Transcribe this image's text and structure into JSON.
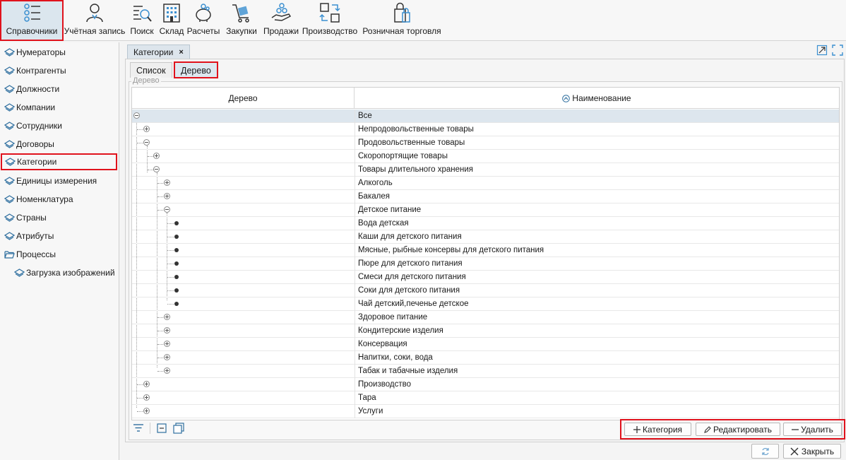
{
  "toolbar": {
    "items": [
      {
        "label": "Справочники",
        "icon": "list-settings-icon"
      },
      {
        "label": "Учётная запись",
        "icon": "user-icon"
      },
      {
        "label": "Поиск",
        "icon": "search-document-icon"
      },
      {
        "label": "Склад",
        "icon": "building-icon"
      },
      {
        "label": "Расчеты",
        "icon": "piggy-bank-icon"
      },
      {
        "label": "Закупки",
        "icon": "cart-icon"
      },
      {
        "label": "Продажи",
        "icon": "hand-coins-icon"
      },
      {
        "label": "Производство",
        "icon": "workflow-icon"
      },
      {
        "label": "Розничная торговля",
        "icon": "shopping-bag-icon"
      }
    ]
  },
  "sidebar": {
    "items": [
      {
        "label": "Нумераторы"
      },
      {
        "label": "Контрагенты"
      },
      {
        "label": "Должности"
      },
      {
        "label": "Компании"
      },
      {
        "label": "Сотрудники"
      },
      {
        "label": "Договоры"
      },
      {
        "label": "Категории"
      },
      {
        "label": "Единицы измерения"
      },
      {
        "label": "Номенклатура"
      },
      {
        "label": "Страны"
      },
      {
        "label": "Атрибуты"
      },
      {
        "label": "Процессы"
      },
      {
        "label": "Загрузка изображений"
      }
    ]
  },
  "doc_tab": {
    "title": "Категории",
    "close": "×"
  },
  "subtabs": [
    {
      "label": "Список"
    },
    {
      "label": "Дерево"
    }
  ],
  "group_label": "Дерево",
  "grid": {
    "columns": [
      "Дерево",
      "Наименование"
    ],
    "rows": [
      {
        "name": "Все"
      },
      {
        "name": "Непродовольственные товары"
      },
      {
        "name": "Продовольственные товары"
      },
      {
        "name": "Скоропортящие товары"
      },
      {
        "name": "Товары длительного хранения"
      },
      {
        "name": "Алкоголь"
      },
      {
        "name": "Бакалея"
      },
      {
        "name": "Детское питание"
      },
      {
        "name": "Вода детская"
      },
      {
        "name": "Каши для детского питания"
      },
      {
        "name": "Мясные, рыбные консервы для детского питания"
      },
      {
        "name": "Пюре для детского питания"
      },
      {
        "name": "Смеси для детского питания"
      },
      {
        "name": "Соки для детского питания"
      },
      {
        "name": "Чай детский,печенье детское"
      },
      {
        "name": "Здоровое питание"
      },
      {
        "name": "Кондитерские изделия"
      },
      {
        "name": "Консервация"
      },
      {
        "name": "Напитки, соки, вода"
      },
      {
        "name": "Табак и табачные изделия"
      },
      {
        "name": "Производство"
      },
      {
        "name": "Тара"
      },
      {
        "name": "Услуги"
      }
    ]
  },
  "actions": {
    "add": "Категория",
    "edit": "Редактировать",
    "delete": "Удалить"
  },
  "footer": {
    "close": "Закрыть"
  },
  "colors": {
    "highlight": "#e0121c",
    "selection": "#dde6ee",
    "accent": "#3a8fd0"
  }
}
